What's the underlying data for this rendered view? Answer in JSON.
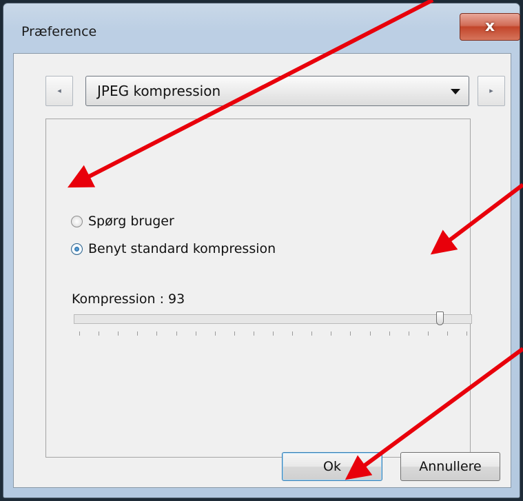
{
  "window": {
    "title": "Præference",
    "close_label": "x"
  },
  "nav": {
    "prev_icon": "left-triangle-icon",
    "next_icon": "right-triangle-icon"
  },
  "category_select": {
    "value": "JPEG kompression"
  },
  "radios": [
    {
      "label": "Spørg bruger",
      "checked": false
    },
    {
      "label": "Benyt standard kompression",
      "checked": true
    }
  ],
  "slider": {
    "label": "Kompression : 93",
    "value": 93,
    "min": 0,
    "max": 100
  },
  "buttons": {
    "ok": "Ok",
    "cancel": "Annullere"
  },
  "annotations": {
    "arrow_color": "#e8000b"
  }
}
